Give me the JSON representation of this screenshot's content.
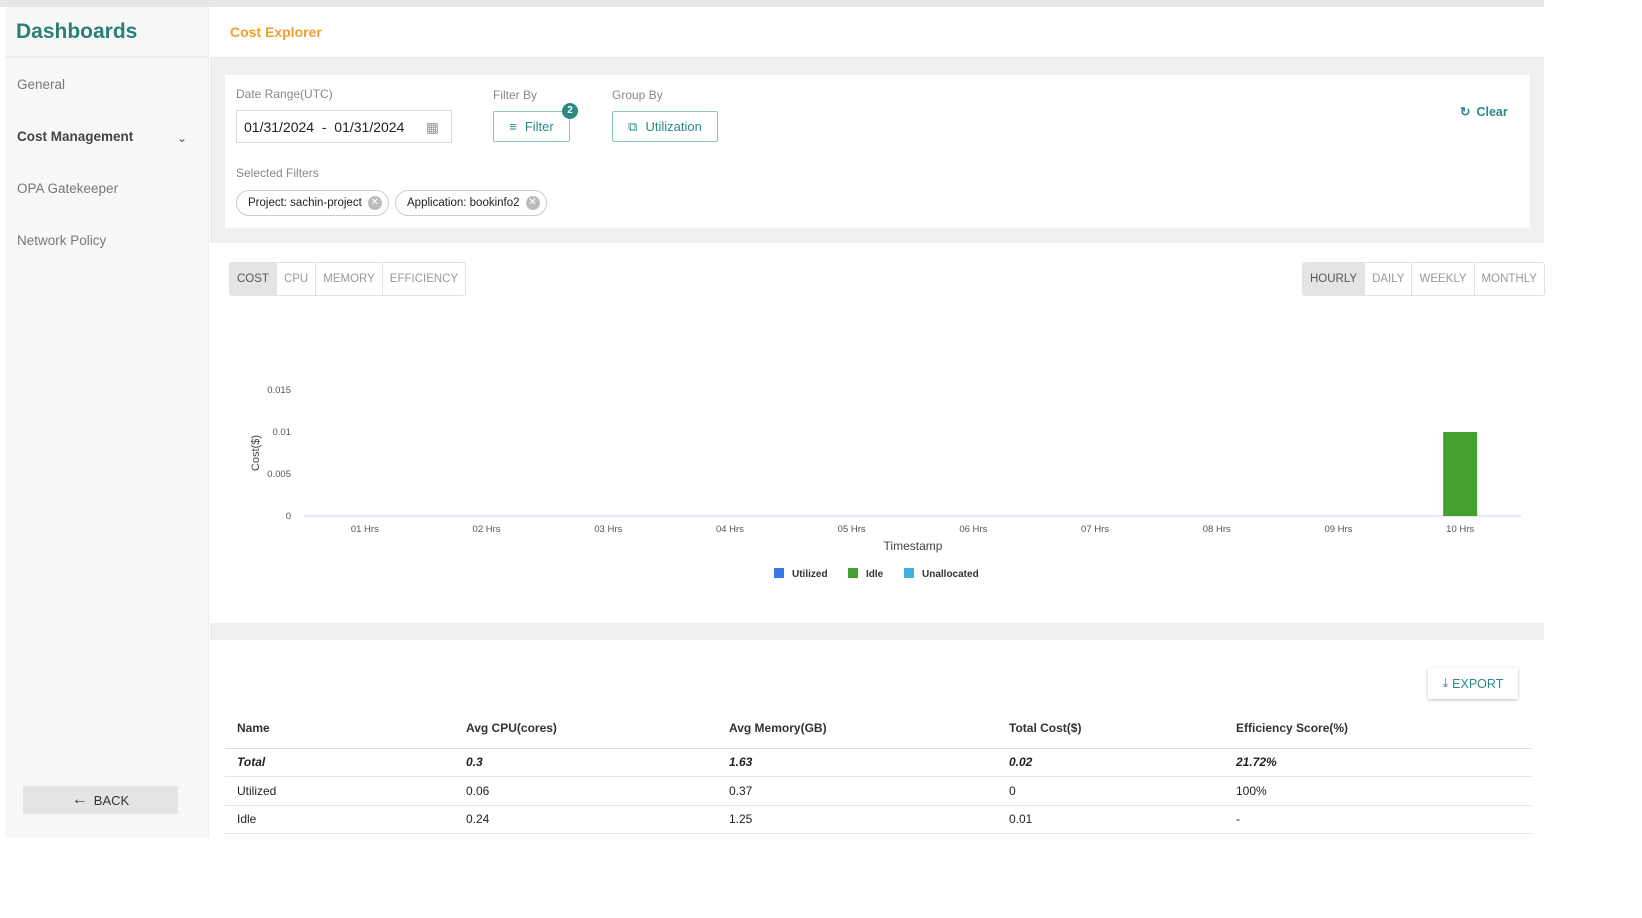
{
  "sidebar": {
    "title": "Dashboards",
    "items": [
      {
        "label": "General"
      },
      {
        "label": "Cost Management"
      },
      {
        "label": "OPA Gatekeeper"
      },
      {
        "label": "Network Policy"
      }
    ],
    "back_label": "BACK"
  },
  "header": {
    "title": "Cost Explorer"
  },
  "filters": {
    "date_label": "Date Range(UTC)",
    "date_value": "01/31/2024  -  01/31/2024",
    "filter_by_label": "Filter By",
    "filter_button": "Filter",
    "filter_count": "2",
    "group_by_label": "Group By",
    "group_button": "Utilization",
    "clear_label": "Clear",
    "selected_label": "Selected Filters",
    "chips": [
      "Project: sachin-project",
      "Application: bookinfo2"
    ]
  },
  "metric_tabs": [
    "COST",
    "CPU",
    "MEMORY",
    "EFFICIENCY"
  ],
  "period_tabs": [
    "HOURLY",
    "DAILY",
    "WEEKLY",
    "MONTHLY"
  ],
  "colors": {
    "accent": "#2a8a83",
    "utilized": "#3b78e7",
    "idle": "#43a02e",
    "unallocated": "#45aee0"
  },
  "chart_data": {
    "type": "bar",
    "stacked": true,
    "xlabel": "Timestamp",
    "ylabel": "Cost($)",
    "ylim": [
      0,
      0.015
    ],
    "yticks": [
      "0",
      "0.005",
      "0.01",
      "0.015"
    ],
    "categories": [
      "01 Hrs",
      "02 Hrs",
      "03 Hrs",
      "04 Hrs",
      "05 Hrs",
      "06 Hrs",
      "07 Hrs",
      "08 Hrs",
      "09 Hrs",
      "10 Hrs"
    ],
    "series": [
      {
        "name": "Utilized",
        "values": [
          0,
          0,
          0,
          0,
          0,
          0,
          0,
          0,
          0,
          0
        ]
      },
      {
        "name": "Idle",
        "values": [
          0,
          0,
          0,
          0,
          0,
          0,
          0,
          0,
          0,
          0.01
        ]
      },
      {
        "name": "Unallocated",
        "values": [
          0,
          0,
          0,
          0,
          0,
          0,
          0,
          0,
          0,
          0
        ]
      }
    ],
    "legend": "bottom"
  },
  "table": {
    "export_label": "EXPORT",
    "headers": [
      "Name",
      "Avg CPU(cores)",
      "Avg Memory(GB)",
      "Total Cost($)",
      "Efficiency Score(%)"
    ],
    "rows": [
      [
        "Total",
        "0.3",
        "1.63",
        "0.02",
        "21.72%"
      ],
      [
        "Utilized",
        "0.06",
        "0.37",
        "0",
        "100%"
      ],
      [
        "Idle",
        "0.24",
        "1.25",
        "0.01",
        "-"
      ]
    ]
  }
}
